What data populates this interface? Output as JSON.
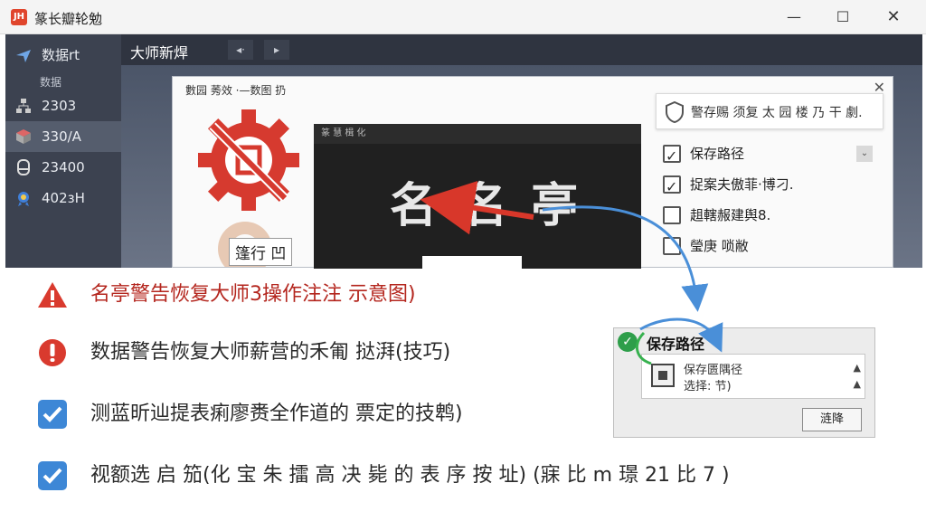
{
  "window": {
    "title": "篆长瓣轮勉",
    "icon_glyph": "JH",
    "minimize_glyph": "—",
    "maximize_glyph": "☐",
    "close_glyph": "✕"
  },
  "sidebar": {
    "items": [
      {
        "label": "数据rt",
        "icon": "plane-icon"
      },
      {
        "label": "2303",
        "icon": "network-icon"
      },
      {
        "label": "330/A",
        "icon": "cube-icon"
      },
      {
        "label": "23400",
        "icon": "disk-icon"
      },
      {
        "label": "402ɜH",
        "icon": "badge-icon"
      }
    ],
    "sub_label": "数据"
  },
  "content_bar": {
    "title": "大师新焊",
    "btn_sound": "◂·",
    "btn_next": "▸"
  },
  "dialog": {
    "title": "數园 莠效 ·—数图 扔",
    "close": "✕",
    "restore_label": "篷行 凹",
    "preview_header": "篆 慧 楫 化",
    "preview_name": "名 名 亭",
    "options_header": "警存赐 须复 太 园 楼  乃 干 劇.",
    "options": [
      {
        "label": "保存路径",
        "checked": true
      },
      {
        "label": "捉案夫傲菲·博刁.",
        "checked": true
      },
      {
        "label": "趄轄赧建舆8.",
        "checked": false
      },
      {
        "label": "瑩庚 唢敝",
        "checked": false
      }
    ],
    "dropdown_glyph": "⌄"
  },
  "tips": [
    {
      "icon": "warning-icon",
      "text": "名亭警告恢复大师3操作注注 示意图)"
    },
    {
      "icon": "error-icon",
      "text": "数据警告恢复大师薪营的禾匍 挞湃(技巧)"
    },
    {
      "icon": "checkbox-icon",
      "text": "测蓝昕辿提表痢廖赉全作道的 票定的技鹎)"
    },
    {
      "icon": "checkbox-icon",
      "text": "视额选 启 笳(化 宝 朱 擂 高 决 毙 的 表 序 按 址) (寐 比 m 璟 21 比 7 )"
    }
  ],
  "zoom_panel": {
    "title": "保存路径",
    "check_glyph": "✓",
    "field_line1": "保存匮隅径",
    "field_line2": "选择: 节)",
    "scroll_up": "▲",
    "scroll_down": "▲",
    "button": "涟降"
  },
  "colors": {
    "accent_red": "#e0452c",
    "accent_blue": "#4a8fd8",
    "check_green": "#2e9e4a"
  }
}
